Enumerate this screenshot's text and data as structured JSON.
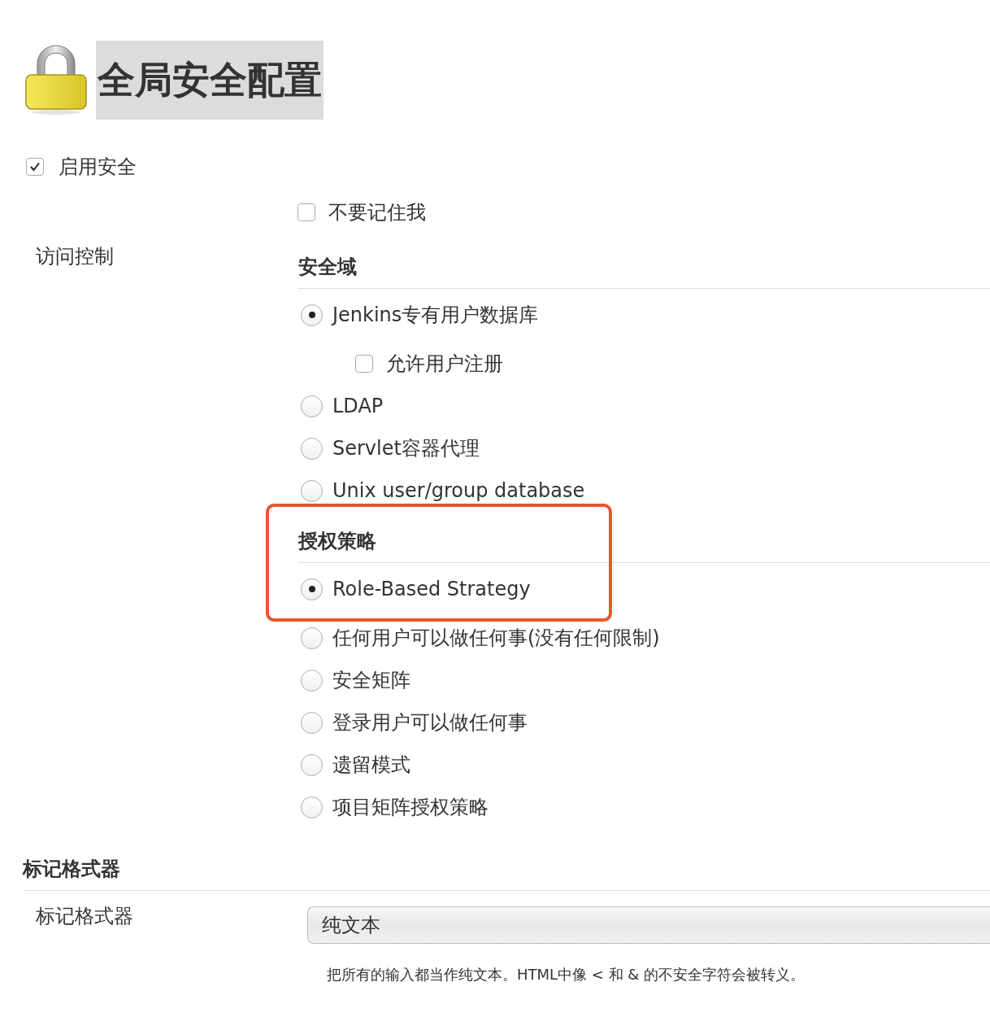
{
  "page_title": "全局安全配置",
  "enable_security": {
    "label": "启用安全",
    "checked": true
  },
  "access_control": {
    "label": "访问控制",
    "remember_me": {
      "label": "不要记住我",
      "checked": false
    },
    "security_realm": {
      "heading": "安全域",
      "options": [
        {
          "label": "Jenkins专有用户数据库",
          "selected": true,
          "children": [
            {
              "label": "允许用户注册",
              "checked": false
            }
          ]
        },
        {
          "label": "LDAP",
          "selected": false
        },
        {
          "label": "Servlet容器代理",
          "selected": false
        },
        {
          "label": "Unix user/group database",
          "selected": false
        }
      ]
    },
    "authorization": {
      "heading": "授权策略",
      "highlighted": true,
      "options": [
        {
          "label": "Role-Based Strategy",
          "selected": true
        },
        {
          "label": "任何用户可以做任何事(没有任何限制)",
          "selected": false
        },
        {
          "label": "安全矩阵",
          "selected": false
        },
        {
          "label": "登录用户可以做任何事",
          "selected": false
        },
        {
          "label": "遗留模式",
          "selected": false
        },
        {
          "label": "项目矩阵授权策略",
          "selected": false
        }
      ]
    }
  },
  "markup_formatter": {
    "heading": "标记格式器",
    "label": "标记格式器",
    "value": "纯文本",
    "description": "把所有的输入都当作纯文本。HTML中像 < 和 & 的不安全字符会被转义。"
  }
}
